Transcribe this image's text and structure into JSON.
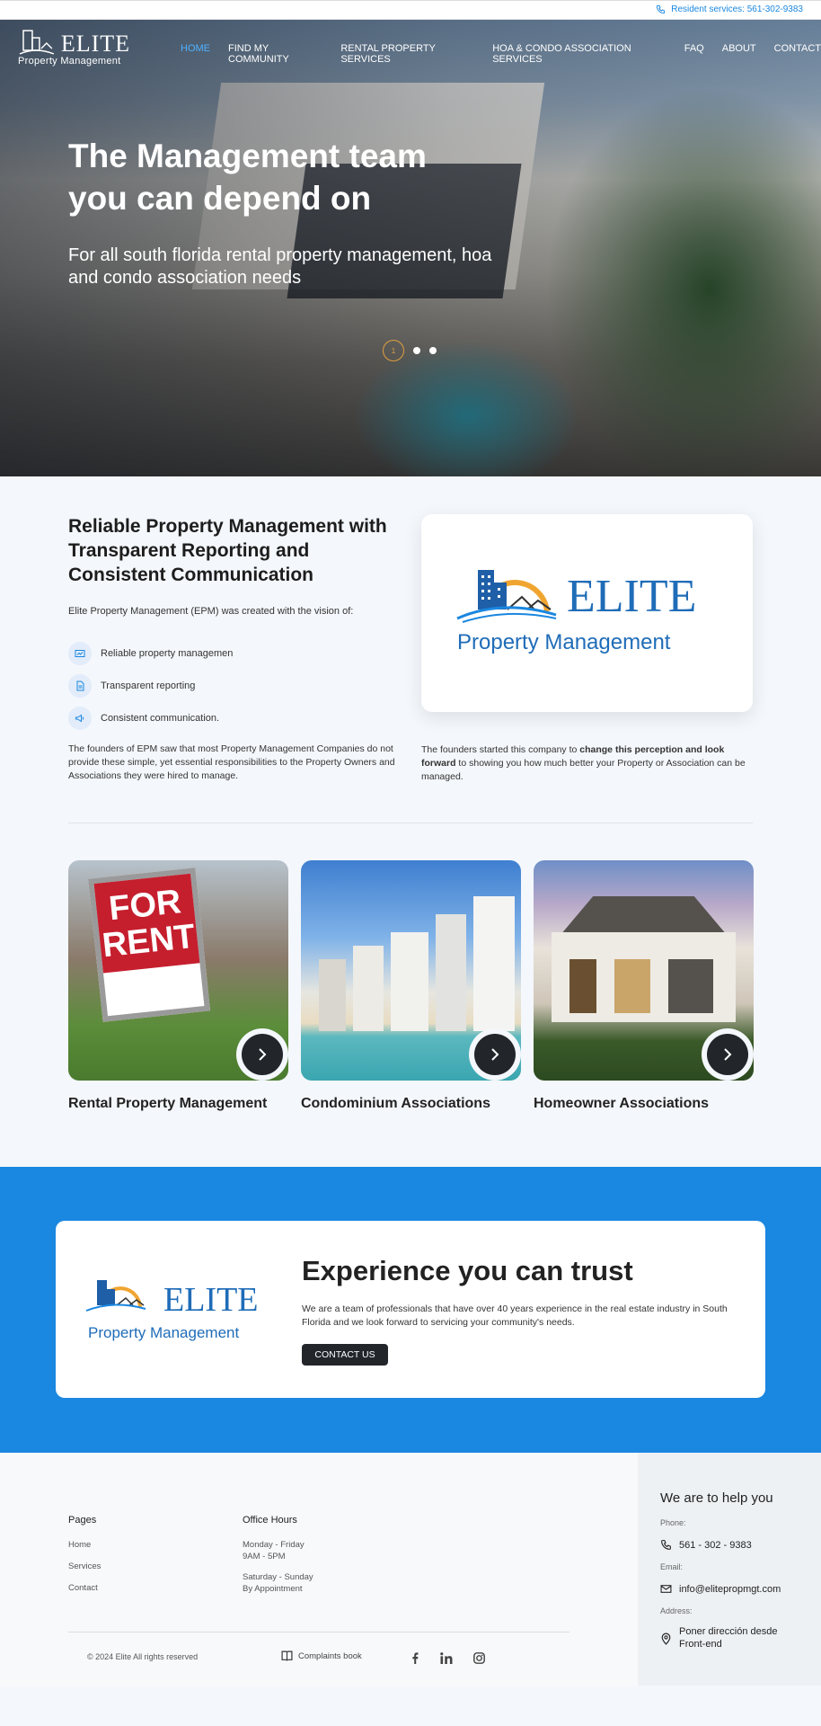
{
  "topbar": {
    "resident_services": "Resident services: 561-302-9383"
  },
  "logo": {
    "word": "ELITE",
    "sub": "Property Management"
  },
  "nav": {
    "items": [
      {
        "label": "HOME",
        "active": true
      },
      {
        "label": "FIND MY COMMUNITY"
      },
      {
        "label": "RENTAL PROPERTY SERVICES"
      },
      {
        "label": "HOA & CONDO ASSOCIATION SERVICES"
      },
      {
        "label": "FAQ"
      },
      {
        "label": "ABOUT"
      },
      {
        "label": "CONTACT"
      }
    ]
  },
  "hero": {
    "title": "The Management team you can depend on",
    "subtitle": "For all south florida rental property management, hoa and condo association needs",
    "active_slide": "1",
    "slide_count": 3
  },
  "about": {
    "title": "Reliable Property Management with Transparent Reporting and Consistent Communication",
    "vision": "Elite Property Management (EPM) was created with the vision of:",
    "features": [
      {
        "label": "Reliable property managemen",
        "icon": "chart-icon"
      },
      {
        "label": "Transparent reporting",
        "icon": "document-icon"
      },
      {
        "label": "Consistent communication.",
        "icon": "megaphone-icon"
      }
    ],
    "left_paragraph": "The founders of EPM saw that most Property Management Companies do not provide these simple, yet essential responsibilities to the Property Owners and Associations they were hired to manage.",
    "right_paragraph": {
      "before": "The founders started this company to ",
      "bold": "change this perception and look forward",
      "after": " to showing you how much better your Property or Association can be managed."
    }
  },
  "cards": [
    {
      "title": "Rental Property Management",
      "image": "for-rent-sign"
    },
    {
      "title": "Condominium Associations",
      "image": "beach-condos"
    },
    {
      "title": "Homeowner Associations",
      "image": "luxury-house"
    }
  ],
  "trust": {
    "title": "Experience you can trust",
    "text": "We are a team of professionals that have over 40 years experience in the real estate industry in South Florida and we look forward to servicing your community's needs.",
    "button": "CONTACT US"
  },
  "footer": {
    "pages_heading": "Pages",
    "pages": [
      "Home",
      "Services",
      "Contact"
    ],
    "hours_heading": "Office Hours",
    "hours": [
      {
        "days": "Monday - Friday",
        "time": "9AM - 5PM"
      },
      {
        "days": "Saturday - Sunday",
        "time": "By Appointment"
      }
    ],
    "copyright": "© 2024 Elite All rights reserved",
    "complaints": "Complaints book",
    "social": [
      "facebook-icon",
      "linkedin-icon",
      "instagram-icon"
    ]
  },
  "help": {
    "title": "We are to help you",
    "phone_label": "Phone:",
    "phone": "561 - 302 - 9383",
    "email_label": "Email:",
    "email": "info@elitepropmgt.com",
    "address_label": "Address:",
    "address": "Poner dirección desde Front-end"
  },
  "colors": {
    "accent": "#1a87e0",
    "dark": "#22262b",
    "nav_active": "#4fb0ff",
    "slider_active": "#e0a040"
  }
}
